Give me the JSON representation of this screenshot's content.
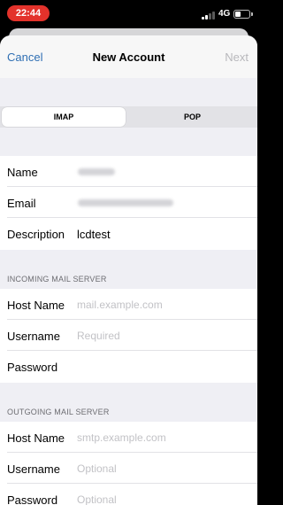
{
  "status_bar": {
    "time": "22:44",
    "network": "4G"
  },
  "nav": {
    "cancel": "Cancel",
    "title": "New Account",
    "next": "Next"
  },
  "segment": {
    "options": [
      "IMAP",
      "POP"
    ],
    "selected": "IMAP"
  },
  "account": {
    "name_label": "Name",
    "email_label": "Email",
    "description_label": "Description",
    "description_value": "lcdtest"
  },
  "incoming": {
    "header": "INCOMING MAIL SERVER",
    "host_label": "Host Name",
    "host_placeholder": "mail.example.com",
    "username_label": "Username",
    "username_placeholder": "Required",
    "password_label": "Password"
  },
  "outgoing": {
    "header": "OUTGOING MAIL SERVER",
    "host_label": "Host Name",
    "host_placeholder": "smtp.example.com",
    "username_label": "Username",
    "username_placeholder": "Optional",
    "password_label": "Password",
    "password_placeholder": "Optional"
  }
}
